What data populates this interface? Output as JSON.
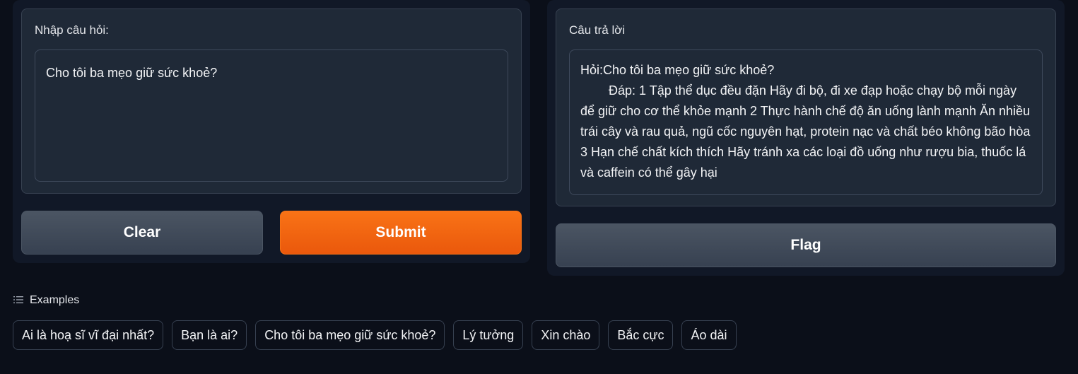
{
  "input": {
    "label": "Nhập câu hỏi:",
    "value": "Cho tôi ba mẹo giữ sức khoẻ?"
  },
  "output": {
    "label": "Câu trả lời",
    "value": "Hỏi:Cho tôi ba mẹo giữ sức khoẻ?\n        Đáp: 1 Tập thể dục đều đặn Hãy đi bộ, đi xe đạp hoặc chạy bộ mỗi ngày để giữ cho cơ thể khỏe mạnh 2 Thực hành chế độ ăn uống lành mạnh Ăn nhiều trái cây và rau quả, ngũ cốc nguyên hạt, protein nạc và chất béo không bão hòa 3 Hạn chế chất kích thích Hãy tránh xa các loại đồ uống như rượu bia, thuốc lá và caffein có thể gây hại"
  },
  "buttons": {
    "clear": "Clear",
    "submit": "Submit",
    "flag": "Flag"
  },
  "examples": {
    "title": "Examples",
    "icon": "list-icon",
    "items": [
      "Ai là hoạ sĩ vĩ đại nhất?",
      "Bạn là ai?",
      "Cho tôi ba mẹo giữ sức khoẻ?",
      "Lý tưởng",
      "Xin chào",
      "Bắc cực",
      "Áo dài"
    ]
  },
  "colors": {
    "background": "#0b0f19",
    "panel": "#111827",
    "primary": "#f97316",
    "secondary": "#4b5563"
  }
}
